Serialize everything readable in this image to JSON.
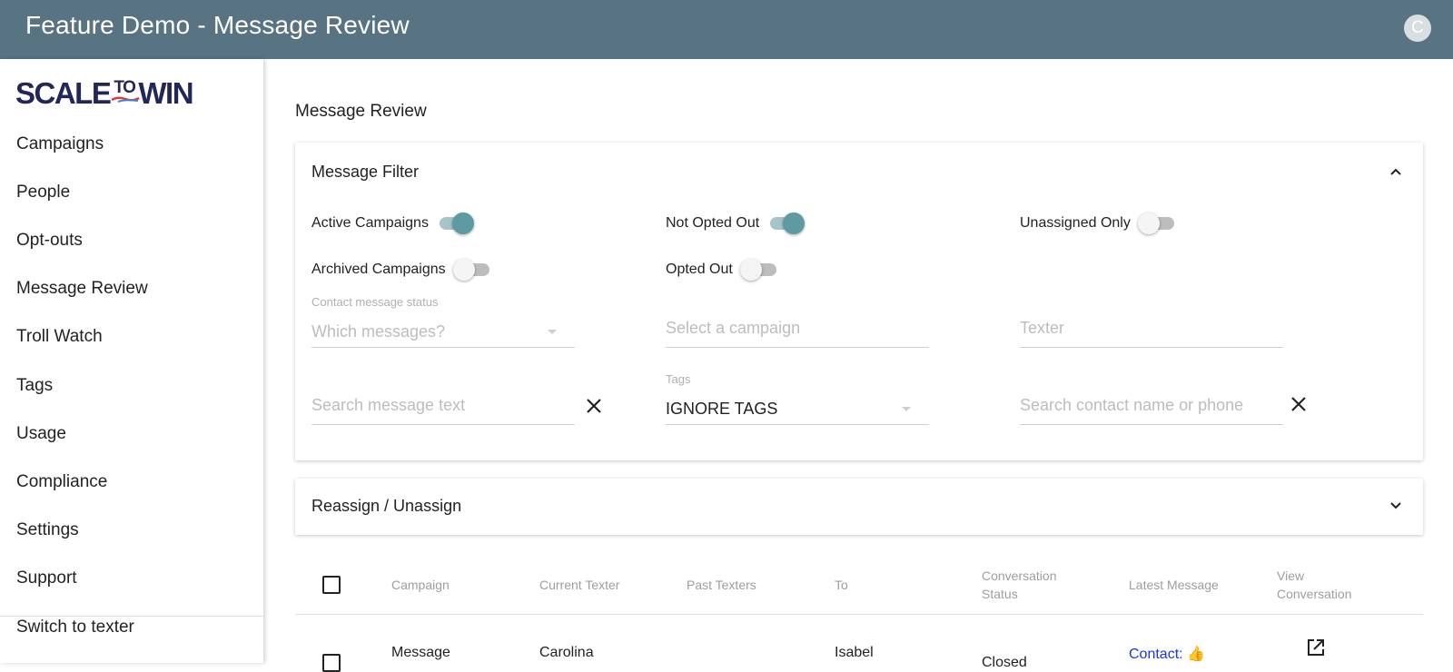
{
  "app": {
    "title": "Feature Demo - Message Review",
    "avatar_letter": "C",
    "header_color": "#587483"
  },
  "logo": {
    "part1": "SCALE",
    "part2": "TO",
    "part3": "WIN"
  },
  "sidebar": {
    "items": [
      {
        "label": "Campaigns"
      },
      {
        "label": "People"
      },
      {
        "label": "Opt-outs"
      },
      {
        "label": "Message Review"
      },
      {
        "label": "Troll Watch"
      },
      {
        "label": "Tags"
      },
      {
        "label": "Usage"
      },
      {
        "label": "Compliance"
      },
      {
        "label": "Settings"
      },
      {
        "label": "Support"
      }
    ],
    "switch_label": "Switch to texter"
  },
  "main": {
    "page_title": "Message Review",
    "filter": {
      "header": "Message Filter",
      "toggles": {
        "active_campaigns": {
          "label": "Active Campaigns",
          "on": true
        },
        "not_opted_out": {
          "label": "Not Opted Out",
          "on": true
        },
        "unassigned_only": {
          "label": "Unassigned Only",
          "on": false
        },
        "archived_campaigns": {
          "label": "Archived Campaigns",
          "on": false
        },
        "opted_out": {
          "label": "Opted Out",
          "on": false
        }
      },
      "contact_status": {
        "label": "Contact message status",
        "placeholder": "Which messages?"
      },
      "campaign": {
        "placeholder": "Select a campaign"
      },
      "texter": {
        "placeholder": "Texter"
      },
      "message_search": {
        "placeholder": "Search message text"
      },
      "tags": {
        "label": "Tags",
        "value": "IGNORE TAGS"
      },
      "contact_search": {
        "placeholder": "Search contact name or phone"
      }
    },
    "reassign": {
      "header": "Reassign / Unassign"
    },
    "table": {
      "headers": {
        "campaign": "Campaign",
        "current_texter": "Current Texter",
        "past_texters": "Past Texters",
        "to": "To",
        "conversation_status_1": "Conversation",
        "conversation_status_2": "Status",
        "latest_message": "Latest Message",
        "view_conversation_1": "View",
        "view_conversation_2": "Conversation"
      },
      "rows": [
        {
          "campaign": "Message",
          "current_texter": "Carolina",
          "to": "Isabel",
          "status": "Closed",
          "latest_message": "Contact: 👍"
        }
      ]
    }
  }
}
